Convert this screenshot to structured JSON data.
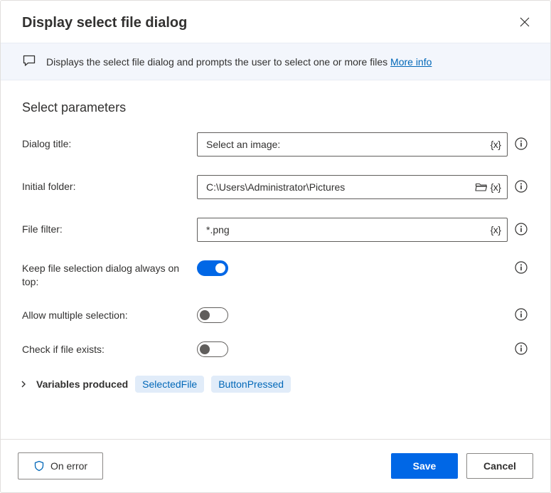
{
  "header": {
    "title": "Display select file dialog"
  },
  "banner": {
    "text": "Displays the select file dialog and prompts the user to select one or more files ",
    "link": "More info"
  },
  "section_title": "Select parameters",
  "fields": {
    "dialog_title": {
      "label": "Dialog title:",
      "value": "Select an image:"
    },
    "initial_folder": {
      "label": "Initial folder:",
      "value": "C:\\Users\\Administrator\\Pictures"
    },
    "file_filter": {
      "label": "File filter:",
      "value": "*.png"
    },
    "always_on_top": {
      "label": "Keep file selection dialog always on top:",
      "on": true
    },
    "multiple": {
      "label": "Allow multiple selection:",
      "on": false
    },
    "check_exists": {
      "label": "Check if file exists:",
      "on": false
    }
  },
  "vars_produced": {
    "label": "Variables produced",
    "items": [
      "SelectedFile",
      "ButtonPressed"
    ]
  },
  "footer": {
    "on_error": "On error",
    "save": "Save",
    "cancel": "Cancel"
  }
}
